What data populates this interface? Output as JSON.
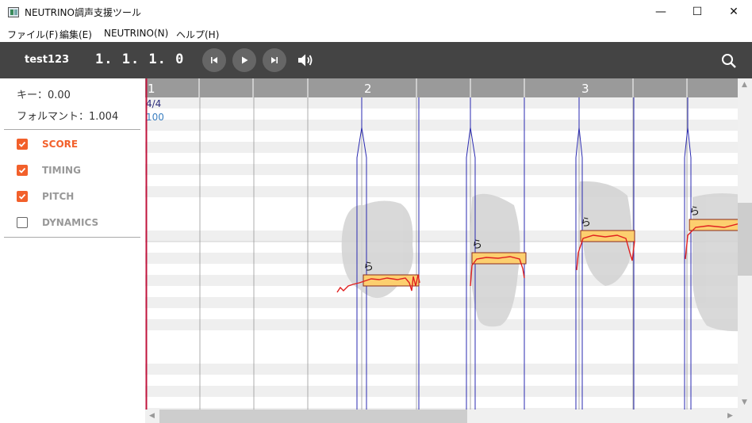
{
  "window": {
    "title": "NEUTRINO調声支援ツール",
    "minimize": "—",
    "maximize": "☐",
    "close": "✕"
  },
  "menu": {
    "items": [
      "ファイル(F)",
      "編集(E)",
      "NEUTRINO(N)",
      "ヘルプ(H)"
    ]
  },
  "toolbar": {
    "project_name": "test123",
    "position": "1. 1. 1. 0",
    "icons": [
      "skip-back-icon",
      "play-icon",
      "skip-forward-icon",
      "volume-icon",
      "search-icon"
    ]
  },
  "panel": {
    "key_label": "キー：0.00",
    "formant_label": "フォルマント：1.004",
    "tracks": [
      {
        "label": "SCORE",
        "checked": true,
        "color": "#f2602b"
      },
      {
        "label": "TIMING",
        "checked": true,
        "color": "#999999"
      },
      {
        "label": "PITCH",
        "checked": true,
        "color": "#999999"
      },
      {
        "label": "DYNAMICS",
        "checked": false,
        "color": "#999999"
      }
    ]
  },
  "editor": {
    "measures": [
      "1",
      "2",
      "3"
    ],
    "time_signature": "4/4",
    "tempo": "100",
    "notes": [
      {
        "lyric": "ら"
      },
      {
        "lyric": "ら"
      },
      {
        "lyric": "ら"
      },
      {
        "lyric": "ら"
      }
    ],
    "colors": {
      "note_fill": "#fccf6f",
      "note_border": "#8b2b1b",
      "pitch_line": "#e02020",
      "timing_line": "#2a2ab0",
      "playhead": "#c0143c",
      "ruler": "#9a9a9a"
    }
  }
}
